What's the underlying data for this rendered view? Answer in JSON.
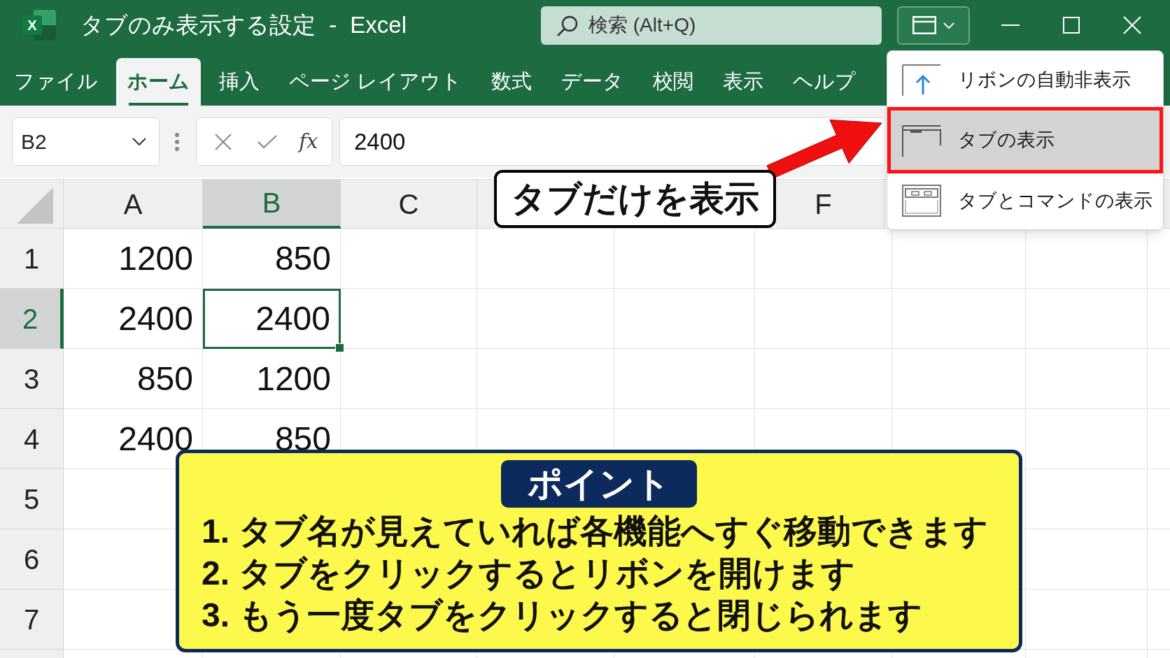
{
  "window": {
    "app_icon_letter": "X",
    "title": "タブのみ表示する設定 - Excel"
  },
  "search": {
    "placeholder": "検索 (Alt+Q)"
  },
  "ribbon_tabs": [
    {
      "label": "ファイル",
      "selected": false
    },
    {
      "label": "ホーム",
      "selected": true
    },
    {
      "label": "挿入",
      "selected": false
    },
    {
      "label": "ページ レイアウト",
      "selected": false
    },
    {
      "label": "数式",
      "selected": false
    },
    {
      "label": "データ",
      "selected": false
    },
    {
      "label": "校閲",
      "selected": false
    },
    {
      "label": "表示",
      "selected": false
    },
    {
      "label": "ヘルプ",
      "selected": false
    }
  ],
  "formula_bar": {
    "name_box": "B2",
    "function_label": "fx",
    "value": "2400"
  },
  "sheet": {
    "columns": [
      {
        "label": "A",
        "selected": false
      },
      {
        "label": "B",
        "selected": true
      },
      {
        "label": "C",
        "selected": false
      },
      {
        "label": "F",
        "selected": false
      }
    ],
    "rows": [
      {
        "label": "1",
        "selected": false,
        "cells": [
          {
            "value": "1200",
            "selected": false
          },
          {
            "value": "850",
            "selected": false
          }
        ]
      },
      {
        "label": "2",
        "selected": true,
        "cells": [
          {
            "value": "2400",
            "selected": false
          },
          {
            "value": "2400",
            "selected": true
          }
        ]
      },
      {
        "label": "3",
        "selected": false,
        "cells": [
          {
            "value": "850",
            "selected": false
          },
          {
            "value": "1200",
            "selected": false
          }
        ]
      },
      {
        "label": "4",
        "selected": false,
        "cells": [
          {
            "value": "2400",
            "selected": false
          },
          {
            "value": "850",
            "selected": false
          }
        ]
      },
      {
        "label": "5",
        "selected": false
      },
      {
        "label": "6",
        "selected": false
      },
      {
        "label": "7",
        "selected": false
      }
    ]
  },
  "display_menu": {
    "items": [
      {
        "label": "リボンの自動非表示",
        "kind": "auto-hide",
        "selected": false,
        "highlighted": false
      },
      {
        "label": "タブの表示",
        "kind": "tabs",
        "selected": true,
        "highlighted": true
      },
      {
        "label": "タブとコマンドの表示",
        "kind": "tabs-commands",
        "selected": false,
        "highlighted": false
      }
    ]
  },
  "callout": {
    "text": "タブだけを表示"
  },
  "point_box": {
    "title": "ポイント",
    "items": [
      "1. タブ名が見えていれば各機能へすぐ移動できます",
      "2. タブをクリックするとリボンを開けます",
      "3. もう一度タブをクリックすると閉じられます"
    ]
  }
}
